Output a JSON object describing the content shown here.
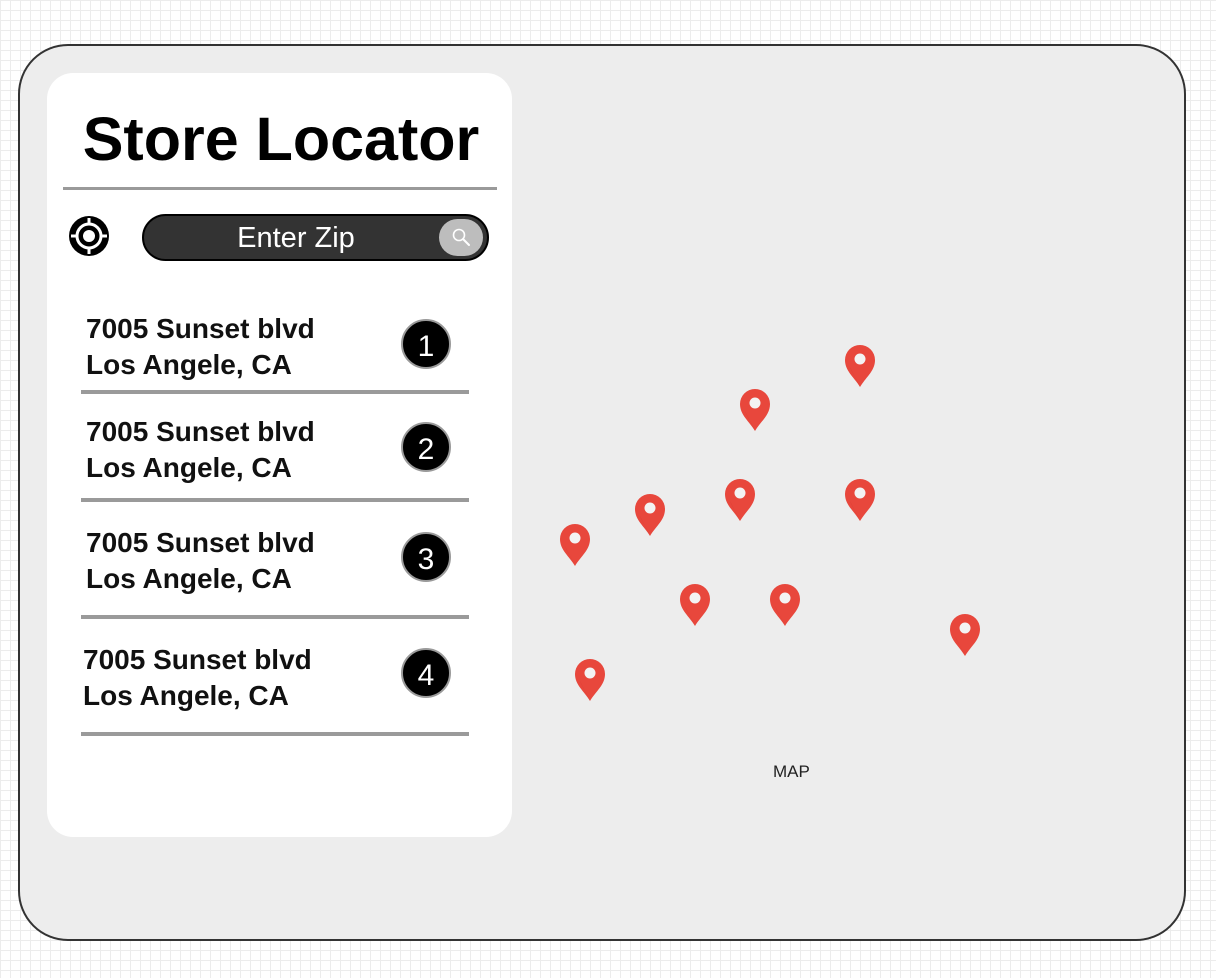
{
  "title": "Store Locator",
  "search": {
    "placeholder": "Enter Zip",
    "button_icon": "search-icon",
    "locate_icon": "crosshair-target-icon"
  },
  "stores": [
    {
      "line1": "7005 Sunset blvd",
      "line2": "Los Angele, CA",
      "number": "1"
    },
    {
      "line1": "7005 Sunset blvd",
      "line2": "Los Angele, CA",
      "number": "2"
    },
    {
      "line1": "7005 Sunset blvd",
      "line2": "Los Angele, CA",
      "number": "3"
    },
    {
      "line1": "7005 Sunset blvd",
      "line2": "Los Angele, CA",
      "number": "4"
    }
  ],
  "map": {
    "label": "MAP",
    "pin_icon": "map-pin-icon",
    "pin_color": "#e8473c"
  },
  "colors": {
    "frame_bg": "#ededed",
    "search_bg": "#333333",
    "badge_bg": "#000000",
    "rule": "#9a9a9a"
  }
}
